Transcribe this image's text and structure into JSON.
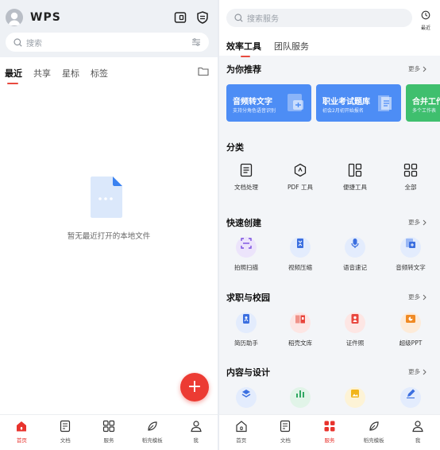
{
  "left": {
    "logo": "WPS",
    "search_placeholder": "搜索",
    "tabs": [
      {
        "label": "最近",
        "active": true
      },
      {
        "label": "共享",
        "active": false
      },
      {
        "label": "星标",
        "active": false
      },
      {
        "label": "标签",
        "active": false
      }
    ],
    "empty_text": "暂无最近打开的本地文件",
    "fab_label": "+"
  },
  "right": {
    "search_placeholder": "搜索服务",
    "recent_label": "最近",
    "tabs": [
      {
        "label": "效率工具",
        "active": true
      },
      {
        "label": "团队服务",
        "active": false
      }
    ],
    "recommend": {
      "title": "为你推荐",
      "more": "更多",
      "cards": [
        {
          "title": "音频转文字",
          "subtitle": "支持分角色语音识别",
          "color": "#4d8df5"
        },
        {
          "title": "职业考试题库",
          "subtitle": "初会2月初开始报名",
          "color": "#4d8df5"
        },
        {
          "title": "合并工作",
          "subtitle": "多个工作表",
          "color": "#3fbf6e"
        }
      ]
    },
    "category": {
      "title": "分类",
      "items": [
        {
          "label": "文档处理",
          "icon": "doc-list-icon"
        },
        {
          "label": "PDF 工具",
          "icon": "pdf-tool-icon"
        },
        {
          "label": "便捷工具",
          "icon": "layout-icon"
        },
        {
          "label": "全部",
          "icon": "grid-icon"
        }
      ]
    },
    "quick_create": {
      "title": "快速创建",
      "more": "更多",
      "items": [
        {
          "label": "拍照扫描",
          "icon": "scan-icon"
        },
        {
          "label": "视频压缩",
          "icon": "compress-icon"
        },
        {
          "label": "语音速记",
          "icon": "voice-icon"
        },
        {
          "label": "音频转文字",
          "icon": "audio-to-text-icon"
        }
      ]
    },
    "job_campus": {
      "title": "求职与校园",
      "more": "更多",
      "items": [
        {
          "label": "简历助手",
          "icon": "resume-icon"
        },
        {
          "label": "稻壳文库",
          "icon": "library-icon"
        },
        {
          "label": "证件照",
          "icon": "id-photo-icon"
        },
        {
          "label": "超级PPT",
          "icon": "ppt-icon"
        }
      ]
    },
    "content_design": {
      "title": "内容与设计",
      "more": "更多"
    }
  },
  "nav": [
    {
      "label": "首页",
      "icon": "home-icon"
    },
    {
      "label": "文档",
      "icon": "document-icon"
    },
    {
      "label": "服务",
      "icon": "services-icon"
    },
    {
      "label": "稻壳模板",
      "icon": "template-leaf-icon"
    },
    {
      "label": "我",
      "icon": "profile-icon"
    }
  ],
  "colors": {
    "accent_red": "#e8332d",
    "card_blue": "#4d8df5",
    "card_green": "#3fbf6e"
  }
}
